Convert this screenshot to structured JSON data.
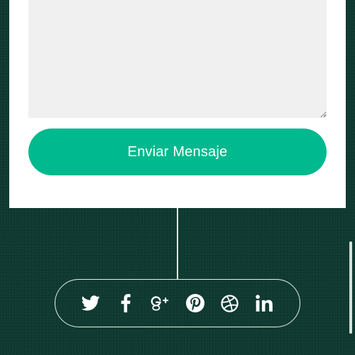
{
  "form": {
    "message_value": "",
    "send_label": "Enviar Mensaje"
  },
  "colors": {
    "page_background": "#0f3a31",
    "card_background": "#ffffff",
    "field_background": "#f0f0f0",
    "accent": "#00b98e",
    "line": "#e8efed"
  },
  "social": {
    "items": [
      {
        "name": "twitter",
        "icon": "twitter-icon"
      },
      {
        "name": "facebook",
        "icon": "facebook-icon"
      },
      {
        "name": "google-plus",
        "icon": "google-plus-icon"
      },
      {
        "name": "pinterest",
        "icon": "pinterest-icon"
      },
      {
        "name": "dribbble",
        "icon": "dribbble-icon"
      },
      {
        "name": "linkedin",
        "icon": "linkedin-icon"
      }
    ]
  }
}
